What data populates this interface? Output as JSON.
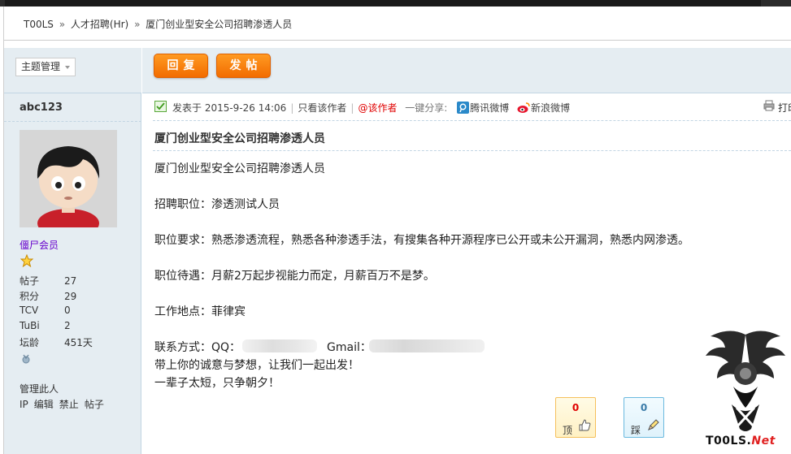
{
  "breadcrumb": {
    "home": "T00LS",
    "section": "人才招聘(Hr)",
    "current": "厦门创业型安全公司招聘渗透人员",
    "separator": "»"
  },
  "sidebar": {
    "topic_select": "主题管理",
    "author": "abc123",
    "user_group": "僵尸会员",
    "stats": [
      {
        "label": "帖子",
        "value": "27"
      },
      {
        "label": "积分",
        "value": "29"
      },
      {
        "label": "TCV",
        "value": "0"
      },
      {
        "label": "TuBi",
        "value": "2"
      },
      {
        "label": "坛龄",
        "value": "451天"
      }
    ],
    "manage_label": "管理此人",
    "manage_links": [
      "IP",
      "编辑",
      "禁止",
      "帖子"
    ]
  },
  "toolbar": {
    "reply_label": "回复",
    "post_label": "发帖"
  },
  "post_meta": {
    "posted": "发表于 2015-9-26 14:06",
    "only_author": "只看该作者",
    "at_author": "@该作者",
    "share_label": "一键分享:",
    "tencent_weibo": "腾讯微博",
    "sina_weibo": "新浪微博",
    "print": "打印"
  },
  "post": {
    "title": "厦门创业型安全公司招聘渗透人员",
    "lines": [
      "厦门创业型安全公司招聘渗透人员",
      "招聘职位：渗透测试人员",
      "职位要求：熟悉渗透流程，熟悉各种渗透手法，有搜集各种开源程序已公开或未公开漏洞，熟悉内网渗透。",
      "职位待遇：月薪2万起步视能力而定，月薪百万不是梦。",
      "工作地点：菲律宾",
      "联系方式：QQ：",
      "Gmail：",
      "带上你的诚意与梦想，让我们一起出发！",
      "一辈子太短，只争朝夕！"
    ]
  },
  "votes": {
    "up": {
      "count": "0",
      "label": "顶"
    },
    "down": {
      "count": "0",
      "label": "踩"
    }
  },
  "watermark": {
    "text": "T00LS.",
    "net": "Net"
  },
  "colors": {
    "accent": "#f26c00",
    "sidebar_bg": "#e5edf2",
    "border": "#c2d5e3",
    "user_group": "#6600cc",
    "at_author": "#e00000"
  }
}
